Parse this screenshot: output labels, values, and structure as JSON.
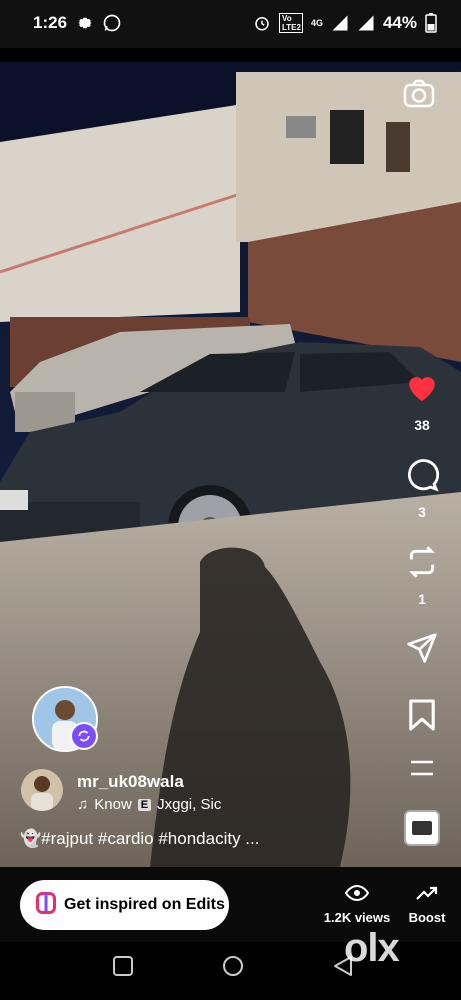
{
  "status_bar": {
    "time": "1:26",
    "network": "4G",
    "battery": "44%",
    "volte": "Vo LTE2"
  },
  "post": {
    "likes": "38",
    "comments": "3",
    "reposts": "1",
    "username": "mr_uk08wala",
    "music_label": "Know",
    "music_badge": "E",
    "music_artist": "Jxggi, Sic",
    "caption": "👻#rajput #cardio #hondacity ..."
  },
  "bottom_bar": {
    "edits_label": "Get inspired on Edits",
    "views_label": "1.2K views",
    "boost_label": "Boost"
  },
  "watermark": "olx",
  "icons": [
    "settings-icon",
    "whatsapp-icon",
    "alarm-icon",
    "signal-icon",
    "battery-icon",
    "camera-icon",
    "heart-icon",
    "comment-icon",
    "repost-icon",
    "share-icon",
    "save-icon",
    "more-icon",
    "audio-icon",
    "edits-icon",
    "views-icon",
    "boost-icon",
    "home-icon",
    "back-icon",
    "recents-icon"
  ],
  "colors": {
    "like": "#ff3040",
    "edits_badge": "#7c4dff"
  }
}
